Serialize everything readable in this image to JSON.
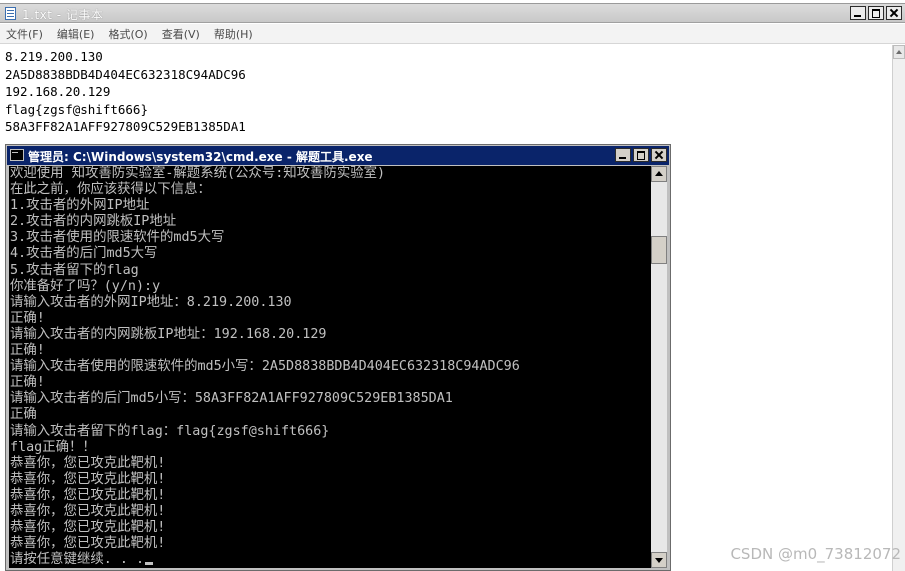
{
  "notepad": {
    "title": "1.txt - 记事本",
    "menu": [
      "文件(F)",
      "编辑(E)",
      "格式(O)",
      "查看(V)",
      "帮助(H)"
    ],
    "lines": [
      "8.219.200.130",
      "2A5D8838BDB4D404EC632318C94ADC96",
      "192.168.20.129",
      "flag{zgsf@shift666}",
      "58A3FF82A1AFF927809C529EB1385DA1"
    ]
  },
  "cmd": {
    "title": "管理员: C:\\Windows\\system32\\cmd.exe - 解题工具.exe",
    "lines": [
      "欢迎使用 知攻善防实验室-解题系统(公众号:知攻善防实验室)",
      "在此之前，你应该获得以下信息：",
      "1.攻击者的外网IP地址",
      "2.攻击者的内网跳板IP地址",
      "3.攻击者使用的限速软件的md5大写",
      "4.攻击者的后门md5大写",
      "5.攻击者留下的flag",
      "你准备好了吗？(y/n):y",
      "请输入攻击者的外网IP地址：8.219.200.130",
      "正确!",
      "请输入攻击者的内网跳板IP地址：192.168.20.129",
      "正确!",
      "请输入攻击者使用的限速软件的md5小写：2A5D8838BDB4D404EC632318C94ADC96",
      "正确!",
      "请输入攻击者的后门md5小写：58A3FF82A1AFF927809C529EB1385DA1",
      "正确",
      "请输入攻击者留下的flag：flag{zgsf@shift666}",
      "flag正确！！",
      "恭喜你，您已攻克此靶机!",
      "恭喜你，您已攻克此靶机!",
      "恭喜你，您已攻克此靶机!",
      "恭喜你，您已攻克此靶机!",
      "恭喜你，您已攻克此靶机!",
      "恭喜你，您已攻克此靶机!",
      "请按任意键继续. . ."
    ]
  },
  "watermark": "CSDN @m0_73812072"
}
